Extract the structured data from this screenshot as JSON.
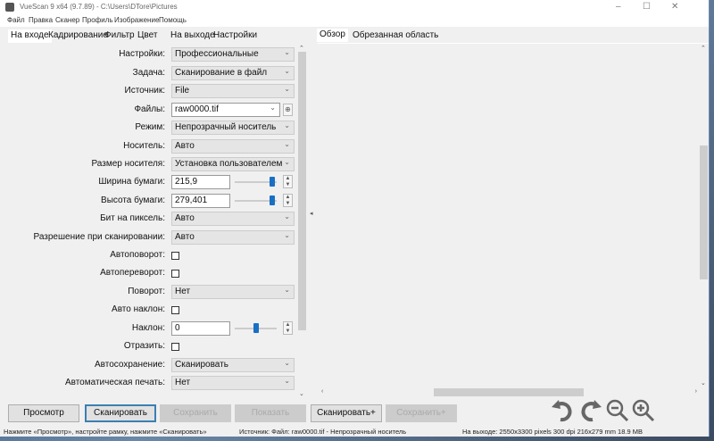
{
  "window": {
    "title": "VueScan 9 x64 (9.7.89) - C:\\Users\\DTore\\Pictures",
    "controls": {
      "minimize": "–",
      "maximize": "☐",
      "close": "✕"
    }
  },
  "menu": [
    "Файл",
    "Правка",
    "Сканер",
    "Профиль",
    "Изображение",
    "Помощь"
  ],
  "left_tabs": [
    "На входе",
    "Кадрирование",
    "Фильтр",
    "Цвет",
    "На выходе",
    "Настройки"
  ],
  "right_tabs": [
    "Обзор",
    "Обрезанная область"
  ],
  "form": {
    "settings": {
      "label": "Настройки:",
      "value": "Профессиональные"
    },
    "task": {
      "label": "Задача:",
      "value": "Сканирование в файл"
    },
    "source": {
      "label": "Источник:",
      "value": "File"
    },
    "files": {
      "label": "Файлы:",
      "value": "raw0000.tif"
    },
    "mode": {
      "label": "Режим:",
      "value": "Непрозрачный носитель"
    },
    "media": {
      "label": "Носитель:",
      "value": "Авто"
    },
    "media_size": {
      "label": "Размер носителя:",
      "value": "Установка пользователем"
    },
    "paper_width": {
      "label": "Ширина бумаги:",
      "value": "215,9",
      "slider_fraction": 0.95
    },
    "paper_height": {
      "label": "Высота бумаги:",
      "value": "279,401",
      "slider_fraction": 0.95
    },
    "bits": {
      "label": "Бит на пиксель:",
      "value": "Авто"
    },
    "resolution": {
      "label": "Разрешение при сканировании:",
      "value": "Авто"
    },
    "auto_rotate": {
      "label": "Автоповорот:",
      "checked": false
    },
    "auto_flip": {
      "label": "Автопереворот:",
      "checked": false
    },
    "rotate": {
      "label": "Поворот:",
      "value": "Нет"
    },
    "auto_skew": {
      "label": "Авто наклон:",
      "checked": false
    },
    "skew": {
      "label": "Наклон:",
      "value": "0",
      "slider_fraction": 0.5
    },
    "mirror": {
      "label": "Отразить:",
      "checked": false
    },
    "autosave": {
      "label": "Автосохранение:",
      "value": "Сканировать"
    },
    "autoprint": {
      "label": "Автоматическая печать:",
      "value": "Нет"
    }
  },
  "buttons": {
    "preview": "Просмотр",
    "scan": "Сканировать",
    "save": "Сохранить",
    "show": "Показать",
    "scan_plus": "Сканировать+",
    "save_plus": "Сохранить+"
  },
  "status": {
    "hint": "Нажмите «Просмотр», настройте рамку, нажмите «Сканировать»",
    "source": "Источник: Файл: raw0000.tif - Непрозрачный носитель",
    "output": "На выходе: 2550x3300 pixels 300 dpi 216x279 mm 18.9 MB"
  }
}
